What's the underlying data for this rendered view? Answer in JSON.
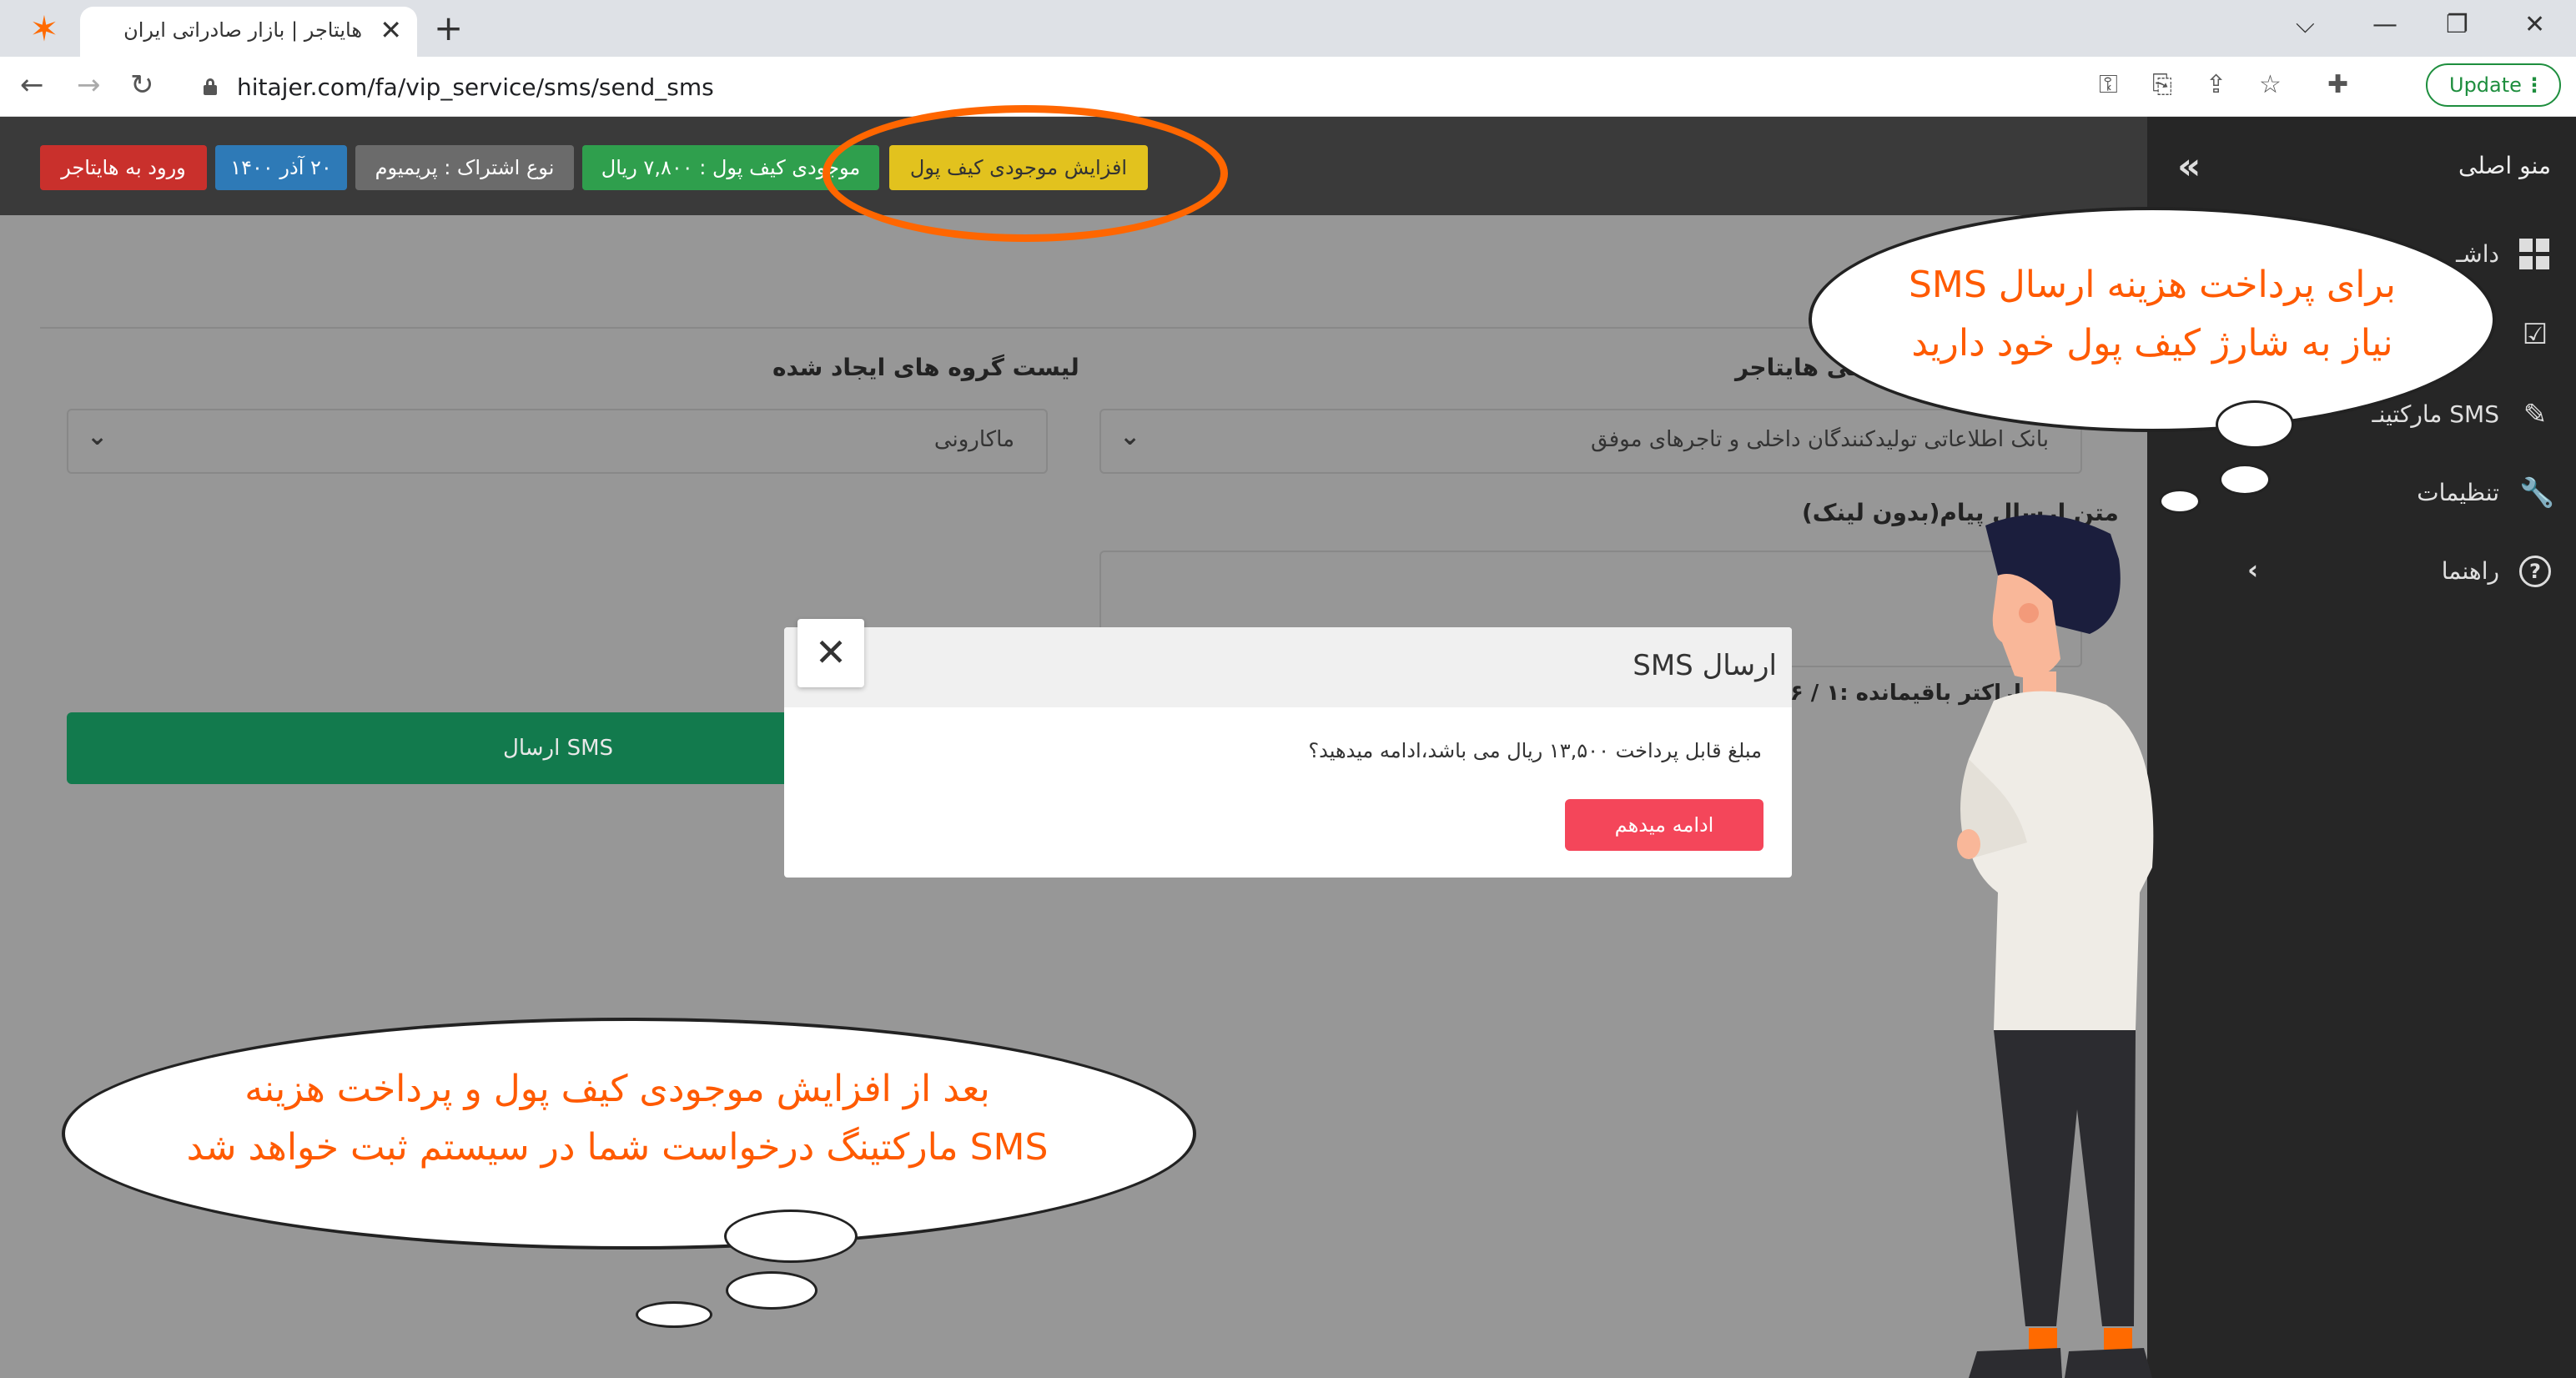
{
  "browser": {
    "tab_title": "هایتاجر | بازار صادراتی ایران",
    "tab_close": "✕",
    "new_tab": "+",
    "url": "hitajer.com/fa/vip_service/sms/send_sms",
    "update_label": "Update",
    "update_menu": "⋮",
    "controls": {
      "back": "←",
      "forward": "→",
      "reload": "↻",
      "minimize": "—",
      "restore": "❐",
      "close": "✕",
      "dropdown": "⌵"
    }
  },
  "topbar": {
    "login_label": "ورود به هایتاجر",
    "date_label": "۲۰ آذر ۱۴۰۰",
    "subscription_label": "نوع اشتراک : پریمیوم",
    "wallet_label": "موجودی کیف پول : ۷,۸۰۰ ریال",
    "increase_wallet_label": "افزایش موجودی کیف پول"
  },
  "sidebar": {
    "collapse": "«",
    "title": "منو اصلی",
    "items": [
      {
        "label": "داشـ",
        "icon": "dashboard-icon"
      },
      {
        "label": "",
        "icon": "checklist-icon"
      },
      {
        "label": "SMS مارکتینـ",
        "icon": "edit-icon"
      },
      {
        "label": "تنظیمات",
        "icon": "wrench-icon"
      },
      {
        "label": "راهنما",
        "icon": "help-icon",
        "chevron": "‹"
      }
    ]
  },
  "form": {
    "list_label": "لیست گروه های ایجاد شده",
    "list_value": "ماکارونی",
    "bank_label": "بانک اطلاعاتی هایتاجر",
    "bank_label_visible": "رانی هایتاجر",
    "bank_value": "بانک اطلاعاتی تولیدکنندگان داخلی و تاجرهای موفق",
    "message_label": "متن ارسال پیام(بدون لینک)",
    "counter": "کاراکتر باقیمانده :۱ / ۵۶",
    "send_label": "ارسال SMS",
    "select_arrow": "⌄"
  },
  "modal": {
    "title": "ارسال SMS",
    "close": "✕",
    "message": "مبلغ قابل پرداخت ۱۳,۵۰۰ ریال می باشد،ادامه میدهید؟",
    "confirm_label": "ادامه میدهم"
  },
  "annotations": {
    "top_bubble_line1": "برای پرداخت هزینه ارسال SMS",
    "top_bubble_line2": "نیاز به شارژ کیف پول خود  دارید",
    "bottom_bubble_line1": "بعد از افزایش موجودی کیف پول و پرداخت  هزینه",
    "bottom_bubble_line2": "SMS  مارکتینگ درخواست شما در سیستم ثبت خواهد شد",
    "text_color": "#ff5a00",
    "highlight_color": "#ff6600"
  },
  "colors": {
    "login": "#c9302c",
    "date": "#2e7ab7",
    "subscription": "#6b6b6b",
    "wallet": "#2f9f4d",
    "increase": "#e2c21e",
    "send": "#127a4d",
    "confirm": "#f4465a"
  }
}
